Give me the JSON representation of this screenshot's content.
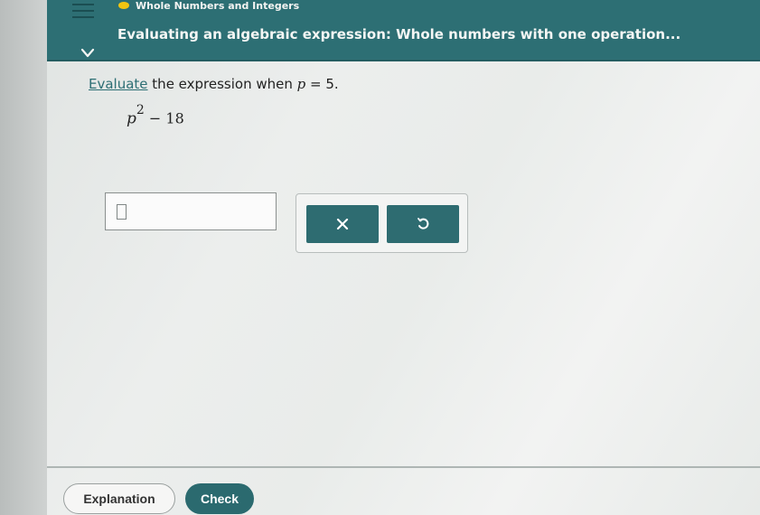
{
  "header": {
    "topic": "Whole Numbers and Integers",
    "title": "Evaluating an algebraic expression: Whole numbers with one operation..."
  },
  "question": {
    "prefix_link": "Evaluate",
    "text": " the expression when ",
    "variable": "p",
    "equals": " = 5."
  },
  "expression": {
    "base": "p",
    "exponent": "2",
    "rest": " − 18"
  },
  "answer": {
    "value": ""
  },
  "actions": {
    "clear_label": "×",
    "undo_label": "↺"
  },
  "footer": {
    "explanation_label": "Explanation",
    "check_label": "Check"
  },
  "colors": {
    "header": "#2d6f74",
    "accent_dot": "#f2c511",
    "button": "#2e6c71"
  },
  "icons": [
    "menu-icon",
    "chevron-down-icon",
    "clear-icon",
    "undo-icon"
  ]
}
